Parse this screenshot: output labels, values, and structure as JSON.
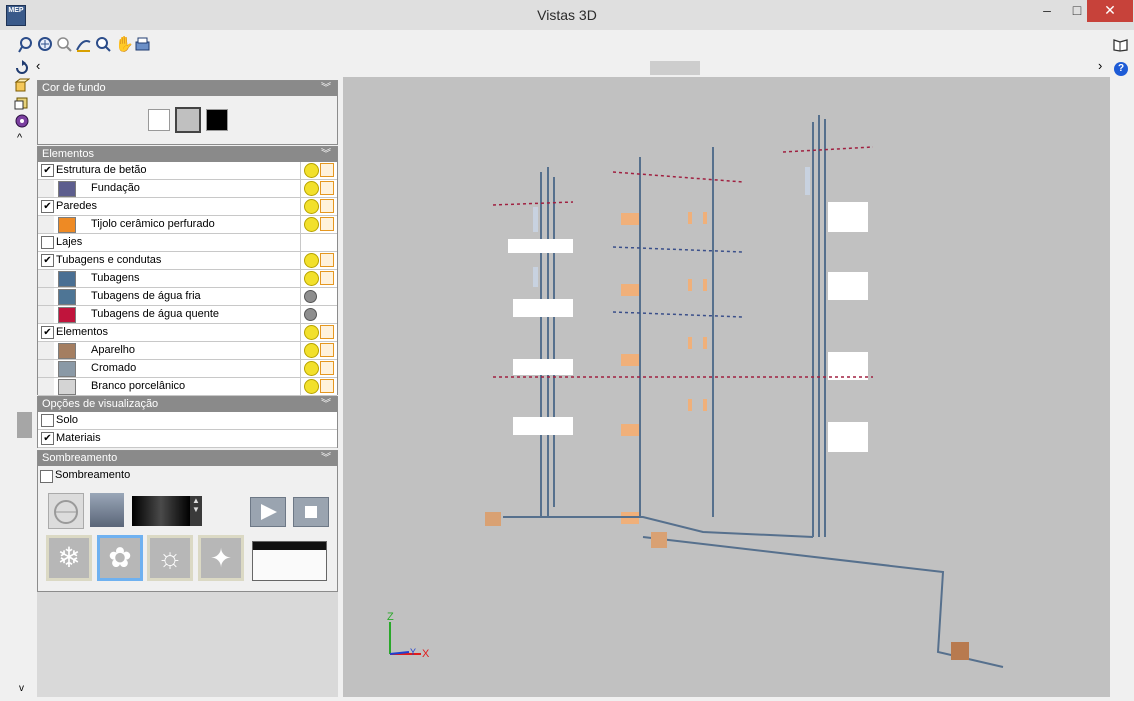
{
  "window": {
    "title": "Vistas 3D",
    "app_icon_text": "MEP",
    "minimize": "–",
    "maximize": "□",
    "close": "✕"
  },
  "toolbar": {
    "icons": [
      "zoom-window-icon",
      "zoom-all-icon",
      "zoom-icon",
      "orbit-icon",
      "zoom-previous-icon",
      "pan-hand-icon",
      "print-icon"
    ],
    "right_icon": "book-icon",
    "help_icon": "help-icon"
  },
  "scroll": {
    "left_arrow": "‹",
    "right_arrow": "›"
  },
  "left_tools": [
    "rotate-icon",
    "view-cube-icon",
    "view-layers-icon",
    "render-eye-icon",
    "collapse-up-icon"
  ],
  "panels": {
    "background": {
      "title": "Cor de fundo",
      "colors": [
        "#ffffff",
        "#c0c0c0",
        "#000000"
      ]
    },
    "elements": {
      "title": "Elementos",
      "rows": [
        {
          "label": "Estrutura de betão",
          "checked": true,
          "level": 0,
          "icons": "yellow"
        },
        {
          "label": "Fundação",
          "level": 1,
          "swatch": "#5d5e8e",
          "icons": "yellow"
        },
        {
          "label": "Paredes",
          "checked": true,
          "level": 0,
          "icons": "yellow"
        },
        {
          "label": "Tijolo cerâmico perfurado",
          "level": 1,
          "swatch": "#ee8a24",
          "icons": "yellow"
        },
        {
          "label": "Lajes",
          "checked": false,
          "level": 0,
          "icons": "none"
        },
        {
          "label": "Tubagens e condutas",
          "checked": true,
          "level": 0,
          "icons": "yellow"
        },
        {
          "label": "Tubagens",
          "level": 1,
          "swatch": "#4a6f93",
          "icons": "yellow"
        },
        {
          "label": "Tubagens de água fria",
          "level": 1,
          "swatch": "#4e7595",
          "icons": "gray"
        },
        {
          "label": "Tubagens de água quente",
          "level": 1,
          "swatch": "#c0143c",
          "icons": "gray"
        },
        {
          "label": "Elementos",
          "checked": true,
          "level": 0,
          "icons": "yellow"
        },
        {
          "label": "Aparelho",
          "level": 1,
          "swatch": "#a47e61",
          "icons": "yellow"
        },
        {
          "label": "Cromado",
          "level": 1,
          "swatch": "#8a99a6",
          "icons": "yellow"
        },
        {
          "label": "Branco porcelânico",
          "level": 1,
          "swatch": "#d4d4d4",
          "icons": "yellow"
        }
      ]
    },
    "view_options": {
      "title": "Opções de visualização",
      "rows": [
        {
          "label": "Solo",
          "checked": false
        },
        {
          "label": "Materiais",
          "checked": true
        }
      ]
    },
    "shading": {
      "title": "Sombreamento",
      "checkbox_label": "Sombreamento",
      "checked": false
    }
  },
  "axis": {
    "z": "Z",
    "x": "X",
    "y": "Y"
  }
}
